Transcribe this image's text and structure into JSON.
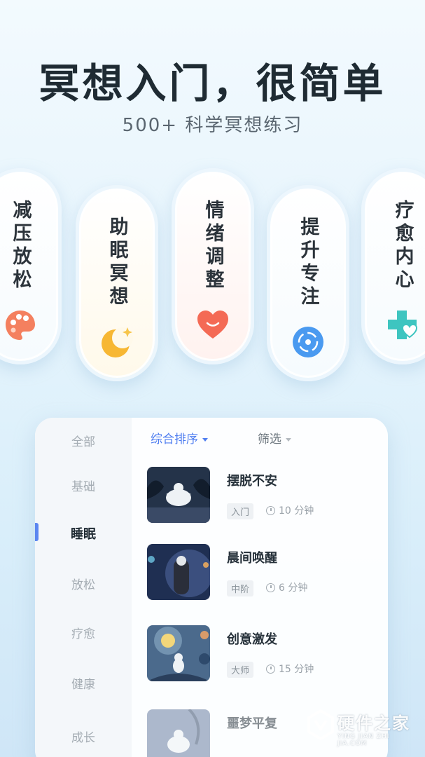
{
  "hero": {
    "title": "冥想入门，很简单",
    "subtitle": "500+ 科学冥想练习"
  },
  "categories": [
    {
      "label": "减压放松",
      "icon": "palette-icon",
      "color": "#f4805f"
    },
    {
      "label": "助眠冥想",
      "icon": "moon-star-icon",
      "color": "#f7b733"
    },
    {
      "label": "情绪调整",
      "icon": "heart-icon",
      "color": "#f46a55"
    },
    {
      "label": "提升专注",
      "icon": "target-icon",
      "color": "#4a9af0"
    },
    {
      "label": "疗愈内心",
      "icon": "medical-heart-icon",
      "color": "#3ec5c0"
    }
  ],
  "sidebar": {
    "items": [
      "全部",
      "基础",
      "睡眠",
      "放松",
      "疗愈",
      "健康",
      "成长"
    ],
    "active": "睡眠"
  },
  "sort": {
    "main": "综合排序",
    "filter": "筛选"
  },
  "list": [
    {
      "title": "摆脱不安",
      "level": "入门",
      "duration": "10 分钟"
    },
    {
      "title": "晨间唤醒",
      "level": "中阶",
      "duration": "6 分钟"
    },
    {
      "title": "创意激发",
      "level": "大师",
      "duration": "15 分钟"
    },
    {
      "title": "噩梦平复",
      "level": "",
      "duration": ""
    }
  ],
  "watermark": {
    "name": "硬件之家",
    "url": "YING JIAN ZHI JIA.COM"
  },
  "colors": {
    "accent": "#4f7ef0",
    "background": "#e3f3fc"
  }
}
